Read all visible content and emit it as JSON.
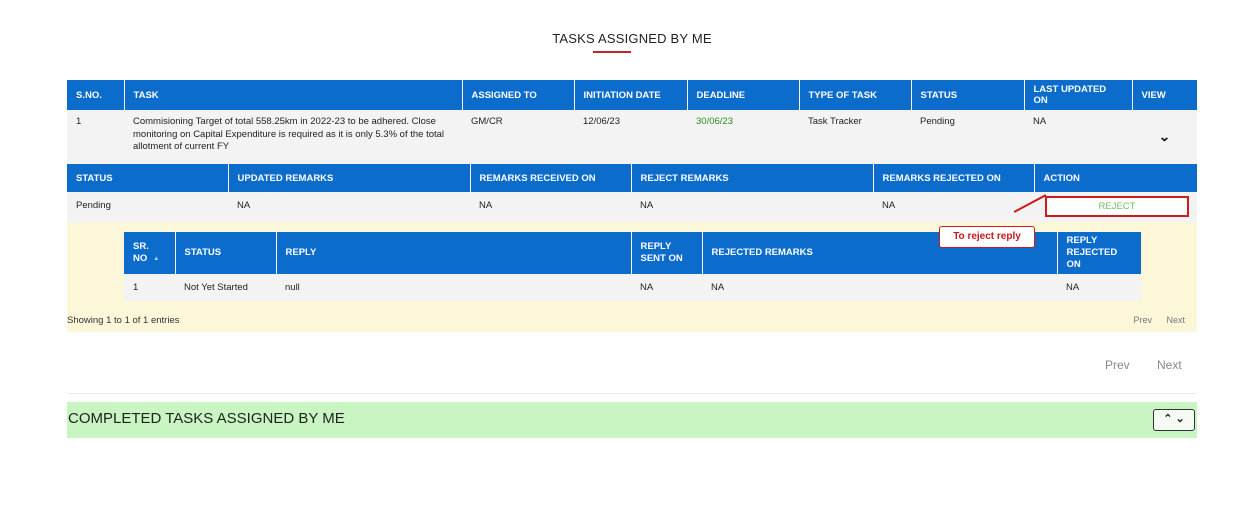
{
  "page": {
    "title": "TASKS ASSIGNED BY ME"
  },
  "main_table": {
    "headers": [
      "S.NO.",
      "TASK",
      "ASSIGNED TO",
      "INITIATION DATE",
      "DEADLINE",
      "TYPE OF TASK",
      "STATUS",
      "LAST UPDATED ON",
      "VIEW"
    ],
    "row": {
      "sno": "1",
      "task": "Commisioning Target of total 558.25km in 2022-23 to be adhered. Close monitoring on Capital Expenditure is required as it is only 5.3% of the total allotment of current FY",
      "assigned_to": "GM/CR",
      "initiation_date": "12/06/23",
      "deadline": "30/06/23",
      "type_of_task": "Task Tracker",
      "status": "Pending",
      "last_updated_on": "NA",
      "view_icon": "double-chevron-down-icon"
    }
  },
  "status_table": {
    "headers": [
      "STATUS",
      "UPDATED REMARKS",
      "REMARKS RECEIVED ON",
      "REJECT REMARKS",
      "REMARKS REJECTED ON",
      "ACTION"
    ],
    "row": {
      "status": "Pending",
      "updated_remarks": "NA",
      "remarks_received_on": "NA",
      "reject_remarks": "NA",
      "remarks_rejected_on": "NA",
      "action_label": "REJECT"
    }
  },
  "tooltip": {
    "text": "To reject reply"
  },
  "reply_table": {
    "headers": [
      "SR. NO",
      "STATUS",
      "REPLY",
      "REPLY SENT ON",
      "REJECTED REMARKS",
      "REPLY REJECTED ON"
    ],
    "row": {
      "sr_no": "1",
      "status": "Not Yet Started",
      "reply": "null",
      "reply_sent_on": "NA",
      "rejected_remarks": "NA",
      "reply_rejected_on": "NA"
    },
    "showing": "Showing 1 to 1 of 1 entries",
    "prev": "Prev",
    "next": "Next"
  },
  "pagination": {
    "prev": "Prev",
    "next": "Next"
  },
  "completed": {
    "title": "COMPLETED TASKS ASSIGNED BY ME",
    "toggle_icon": "double-chevron-up-down-icon"
  },
  "colors": {
    "header_blue": "#0b6ccc",
    "accent_red": "#c0262d",
    "green_bar": "#c8f5c2",
    "yellow_panel": "#fdf7da",
    "deadline_green": "#2e8b1f"
  }
}
